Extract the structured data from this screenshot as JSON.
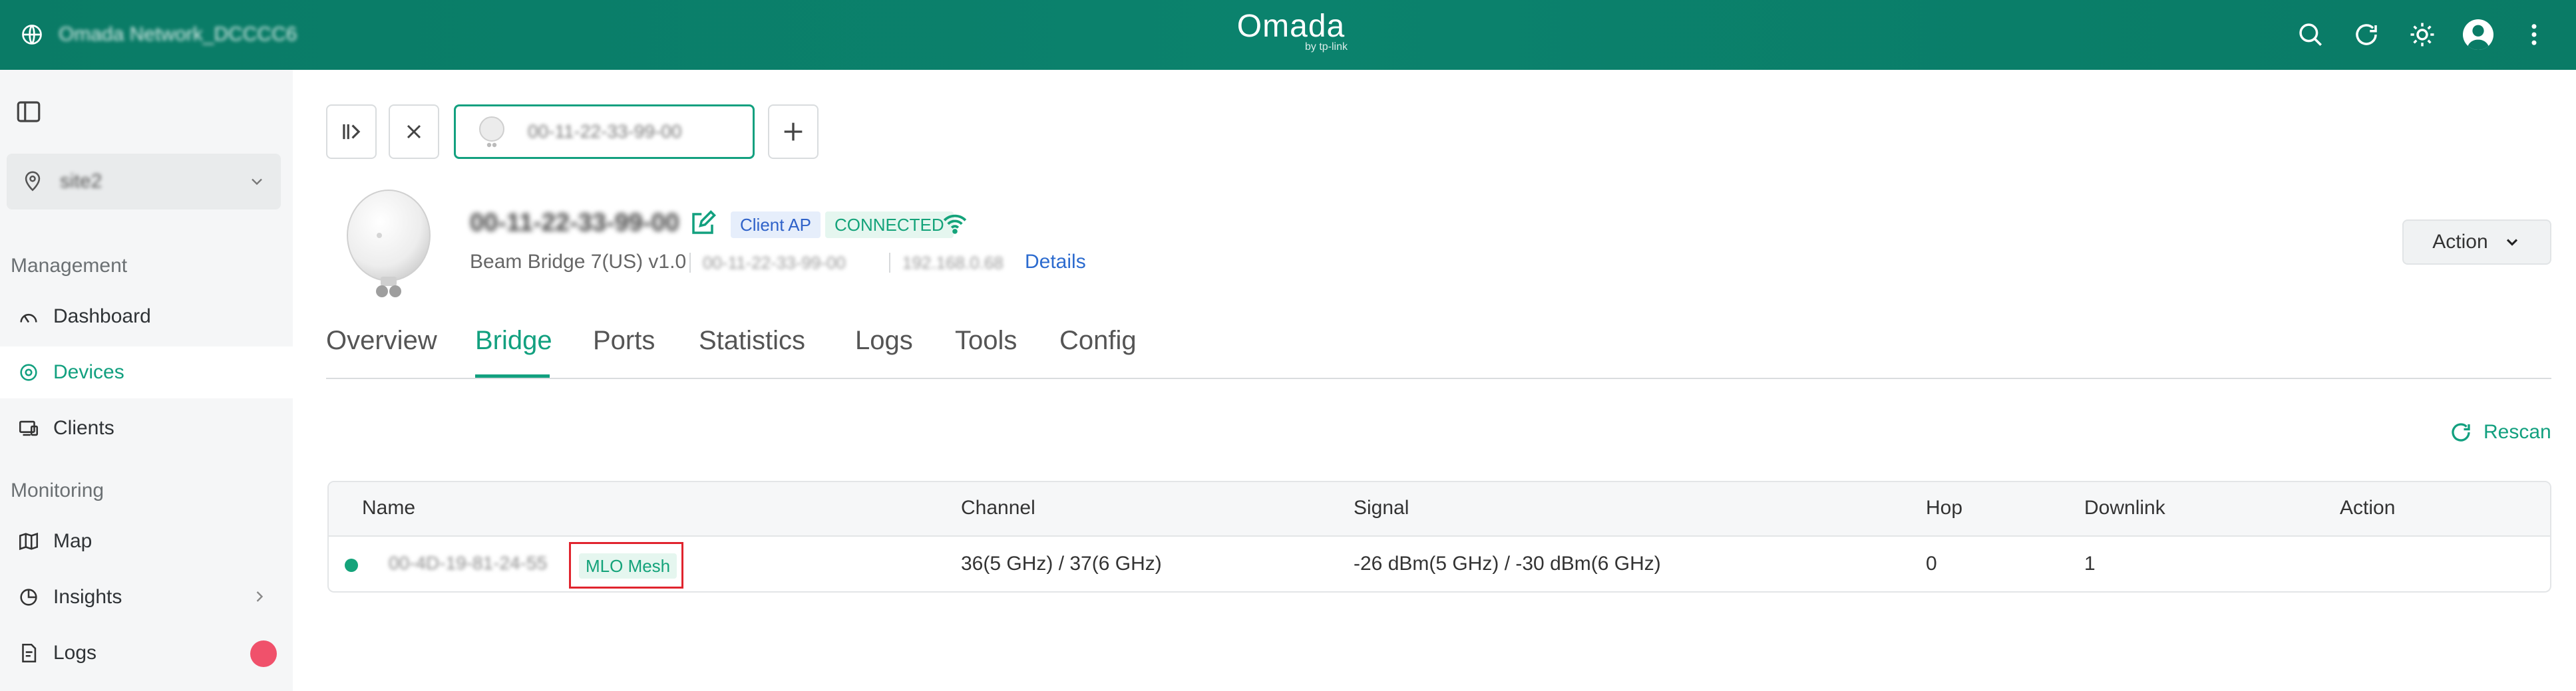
{
  "header": {
    "network_name": "Omada Network_DCCCC6",
    "logo_text": "Omada",
    "logo_sub": "by tp-link",
    "icons": [
      "search-icon",
      "refresh-icon",
      "theme-icon",
      "avatar",
      "more-icon"
    ]
  },
  "sidebar": {
    "site": "site2",
    "groups": {
      "management": "Management",
      "monitoring": "Monitoring"
    },
    "items": [
      {
        "label": "Dashboard",
        "icon": "dashboard-icon"
      },
      {
        "label": "Devices",
        "icon": "devices-icon",
        "active": true
      },
      {
        "label": "Clients",
        "icon": "clients-icon"
      },
      {
        "label": "Map",
        "icon": "map-icon"
      },
      {
        "label": "Insights",
        "icon": "insights-icon"
      },
      {
        "label": "Logs",
        "icon": "logs-icon"
      }
    ]
  },
  "toolbar": {
    "open_tab_mac": "00-11-22-33-99-00"
  },
  "device": {
    "title": "00-11-22-33-99-00",
    "type_tag": "Client AP",
    "status_tag": "CONNECTED",
    "model": "Beam Bridge 7(US) v1.0",
    "mac": "00-11-22-33-99-00",
    "ip": "192.168.0.68",
    "details_link": "Details",
    "action_label": "Action"
  },
  "tabs": [
    "Overview",
    "Bridge",
    "Ports",
    "Statistics",
    "Logs",
    "Tools",
    "Config"
  ],
  "active_tab": "Bridge",
  "rescan_label": "Rescan",
  "table": {
    "columns": [
      "Name",
      "Channel",
      "Signal",
      "Hop",
      "Downlink",
      "Action"
    ],
    "rows": [
      {
        "name": "00-4D-19-81-24-55",
        "tag": "MLO Mesh",
        "channel": "36(5 GHz) / 37(6 GHz)",
        "signal": "-26 dBm(5 GHz) / -30 dBm(6 GHz)",
        "hop": "0",
        "downlink": "1",
        "action": ""
      }
    ]
  },
  "colors": {
    "brand": "#0a7b66",
    "accent": "#12a07f",
    "link": "#2c6bcf",
    "highlight_box": "#e0242e"
  }
}
